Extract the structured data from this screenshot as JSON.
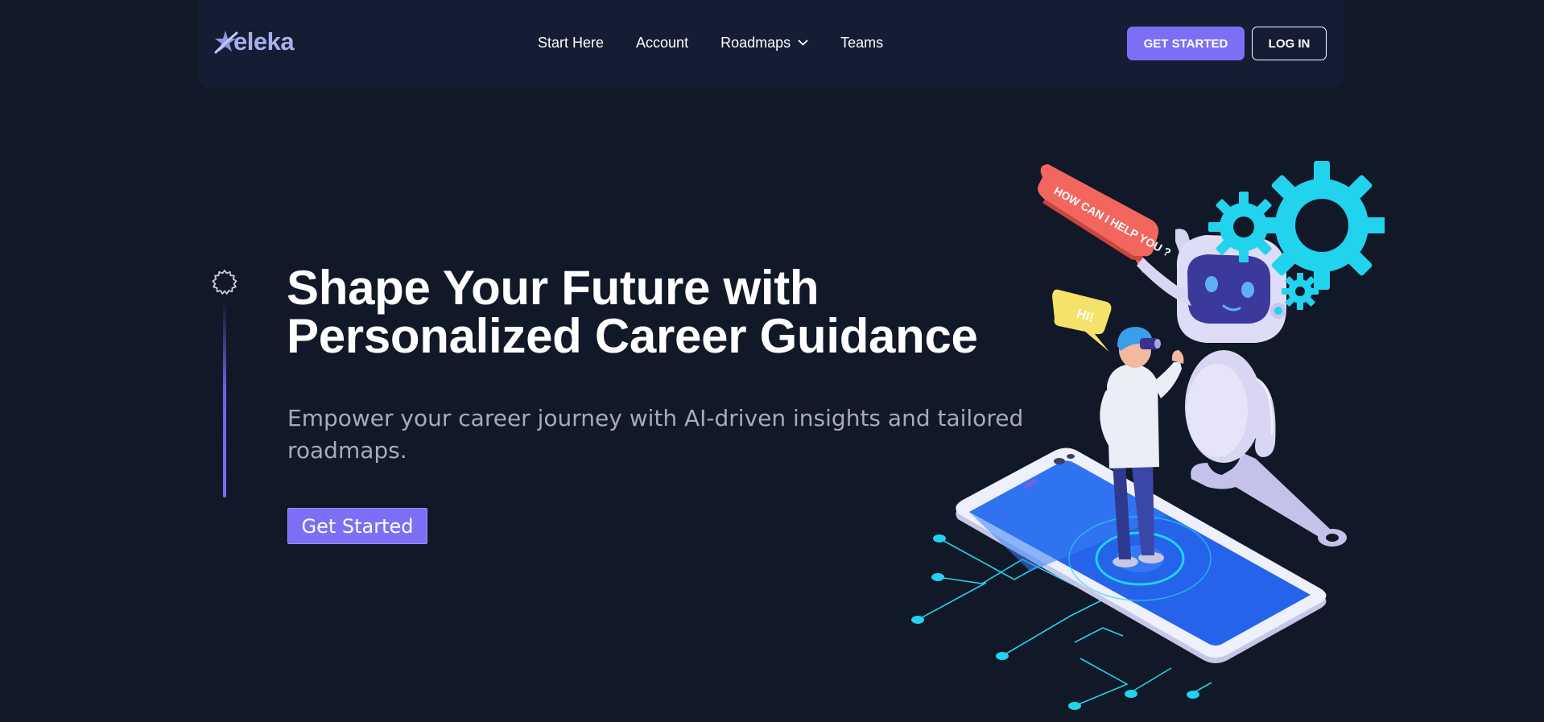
{
  "brand": {
    "name": "eleka",
    "accent_color": "#7c6ff5",
    "background_color": "#111827",
    "logo_icon": "star-swoosh-icon"
  },
  "nav": {
    "links": [
      {
        "label": "Start Here"
      },
      {
        "label": "Account"
      },
      {
        "label": "Roadmaps",
        "icon": "chevron-down-icon"
      },
      {
        "label": "Teams"
      }
    ],
    "get_started_label": "GET STARTED",
    "login_label": "LOG IN"
  },
  "hero": {
    "timeline_icon": "gear-outline-icon",
    "title_line1": "Shape Your Future with",
    "title_line2": "Personalized Career Guidance",
    "subtitle": "Empower your career journey with AI-driven insights and tailored roadmaps.",
    "cta_label": "Get Started"
  },
  "illustration": {
    "speech_bubble_robot": "HOW CAN I HELP YOU ?",
    "speech_bubble_person": "HI!",
    "colors": {
      "gear": "#22d3ee",
      "bubble_red": "#f2665e",
      "bubble_yellow": "#f5e26b",
      "phone_screen": "#2563eb"
    }
  }
}
